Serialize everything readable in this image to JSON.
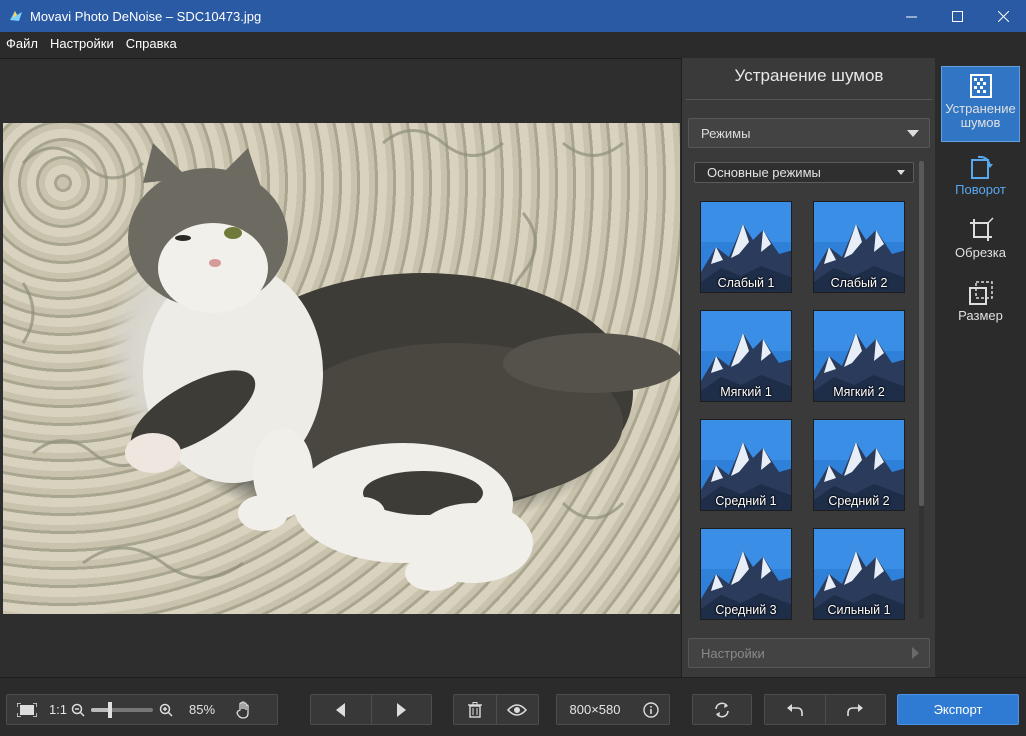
{
  "window": {
    "title": "Movavi Photo DeNoise – SDC10473.jpg",
    "minimize": "—",
    "maximize": "☐",
    "close": "✕"
  },
  "menu": [
    "Файл",
    "Настройки",
    "Справка"
  ],
  "panel": {
    "title": "Устранение шумов",
    "modes_header": "Режимы",
    "preset_select": "Основные режимы",
    "presets": [
      "Слабый 1",
      "Слабый 2",
      "Мягкий 1",
      "Мягкий 2",
      "Средний 1",
      "Средний 2",
      "Средний 3",
      "Сильный 1"
    ],
    "settings_header": "Настройки"
  },
  "tools": {
    "denoise": "Устранение шумов",
    "rotate": "Поворот",
    "crop": "Обрезка",
    "resize": "Размер"
  },
  "bottom": {
    "fit_icon": "fit-screen-icon",
    "one_to_one": "1:1",
    "zoom_percent": "85%",
    "zoom_level": 0.3,
    "image_size": "800×580",
    "export": "Экспорт"
  },
  "colors": {
    "titlebar": "#2b5aa4",
    "accent": "#3176c4",
    "export": "#2f7bd3",
    "panel": "#3a3a3a"
  }
}
